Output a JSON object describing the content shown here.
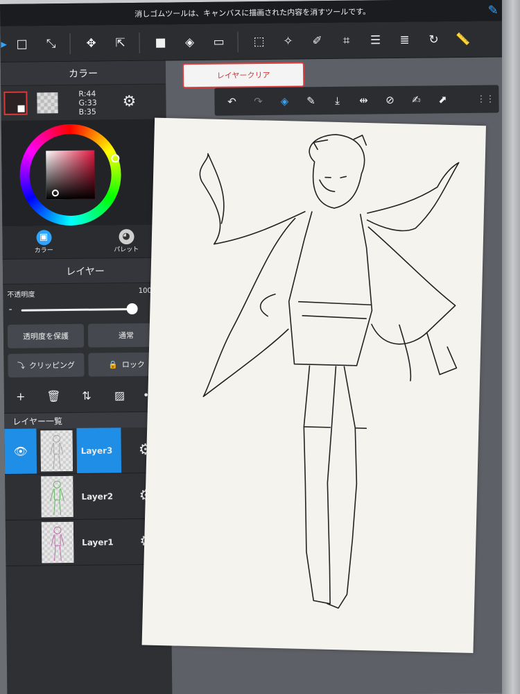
{
  "hint_bar": {
    "text": "消しゴムツールは、キャンバスに描画された内容を消すツールです。"
  },
  "toolbar": {
    "tools": [
      "selection-tool",
      "transform-tool",
      "move-tool",
      "export-tool",
      "fill-color",
      "bucket-tool",
      "gradient-tool",
      "select-rect",
      "magic-wand",
      "edit-tool",
      "crop-tool",
      "document-tool",
      "layer-tool",
      "rotate-tool",
      "ruler-tool",
      "pen-tool"
    ]
  },
  "color_panel": {
    "header": "カラー",
    "r": "R:44",
    "g": "G:33",
    "b": "B:35",
    "main_color": "#2c2123",
    "tabs": [
      {
        "label": "カラー",
        "active": true
      },
      {
        "label": "パレット",
        "active": false
      }
    ]
  },
  "layer_panel": {
    "header": "レイヤー",
    "opacity_label": "不透明度",
    "opacity_value": "100%",
    "opacity": 1.0,
    "protect_alpha": "透明度を保護",
    "blend_mode": "通常",
    "clipping": "クリッピング",
    "lock": "ロック",
    "list_header": "レイヤー一覧",
    "layers": [
      {
        "name": "Layer3",
        "selected": true,
        "visible": true
      },
      {
        "name": "Layer2",
        "selected": false,
        "visible": false
      },
      {
        "name": "Layer1",
        "selected": false,
        "visible": false
      }
    ]
  },
  "canvas": {
    "clear_label": "レイヤークリア",
    "accent": "#2ea3ff",
    "clear_accent": "#d94040"
  }
}
